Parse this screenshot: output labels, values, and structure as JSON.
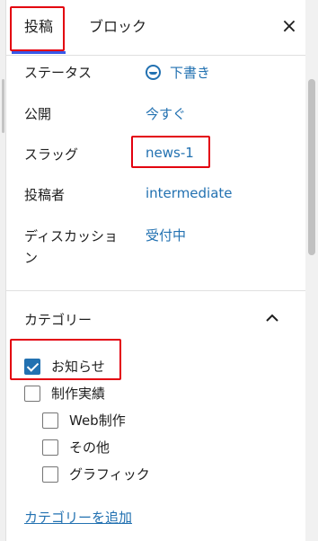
{
  "tabs": {
    "post": "投稿",
    "block": "ブロック",
    "close": "×"
  },
  "summary": [
    {
      "label": "ステータス",
      "value": "下書き"
    },
    {
      "label": "公開",
      "value": "今すぐ"
    },
    {
      "label": "スラッグ",
      "value": "news-1"
    },
    {
      "label": "投稿者",
      "value": "intermediate"
    },
    {
      "label": "ディスカッション",
      "value": "受付中"
    }
  ],
  "categories": {
    "title": "カテゴリー",
    "items": [
      {
        "label": "お知らせ",
        "checked": true,
        "level": 0
      },
      {
        "label": "制作実績",
        "checked": false,
        "level": 0
      },
      {
        "label": "Web制作",
        "checked": false,
        "level": 1
      },
      {
        "label": "その他",
        "checked": false,
        "level": 1
      },
      {
        "label": "グラフィック",
        "checked": false,
        "level": 1
      }
    ],
    "add_link": "カテゴリーを追加"
  },
  "colors": {
    "accent": "#2271b1",
    "highlight": "#e3000f",
    "tab_indicator": "#3858e9"
  }
}
